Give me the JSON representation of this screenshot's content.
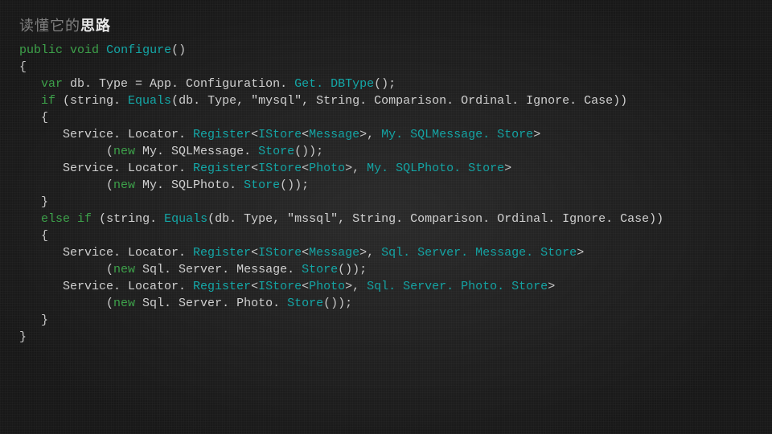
{
  "slide": {
    "title_gray": "读懂它的",
    "title_white": "思路"
  },
  "code": {
    "l01_kw1": "public",
    "l01_kw2": "void",
    "l01_fn": "Configure",
    "l01_tail": "()",
    "l02": "{",
    "l03_indent": "   ",
    "l03_kw": "var",
    "l03_lhs": " db. Type = App. Configuration. ",
    "l03_fn": "Get. DBType",
    "l03_tail": "();",
    "l04_pre": "   if (string. ",
    "l04_fn": "Equals",
    "l04_mid": "(db. Type, \"mysql\", String. Comparison. Ordinal. Ignore. Case))",
    "l04_kw": "if",
    "l05": "   {",
    "l06_pre": "      Service. Locator. ",
    "l06_fn1": "Register",
    "l06_lt1": "<",
    "l06_t1": "IStore",
    "l06_lt2": "<",
    "l06_t2": "Message",
    "l06_gt2": ">",
    "l06_c": ", ",
    "l06_t3": "My. SQLMessage. Store",
    "l06_gt1": ">",
    "l07_pre": "            (",
    "l07_kw": "new",
    "l07_mid": " My. SQLMessage. ",
    "l07_fn": "Store",
    "l07_tail": "());",
    "l08_pre": "      Service. Locator. ",
    "l08_fn1": "Register",
    "l08_t1": "IStore",
    "l08_t2": "Photo",
    "l08_t3": "My. SQLPhoto. Store",
    "l09_pre": "            (",
    "l09_kw": "new",
    "l09_mid": " My. SQLPhoto. ",
    "l09_fn": "Store",
    "l09_tail": "());",
    "l10": "   }",
    "l11_kw1": "else",
    "l11_kw2": "if",
    "l11_pre": "   ",
    "l11_mid": " (string. ",
    "l11_fn": "Equals",
    "l11_tail": "(db. Type, \"mssql\", String. Comparison. Ordinal. Ignore. Case))",
    "l12": "   {",
    "l13_pre": "      Service. Locator. ",
    "l13_fn1": "Register",
    "l13_t1": "IStore",
    "l13_t2": "Message",
    "l13_t3": "Sql. Server. Message. Store",
    "l14_pre": "            (",
    "l14_kw": "new",
    "l14_mid": " Sql. Server. Message. ",
    "l14_fn": "Store",
    "l14_tail": "());",
    "l15_pre": "      Service. Locator. ",
    "l15_fn1": "Register",
    "l15_t1": "IStore",
    "l15_t2": "Photo",
    "l15_t3": "Sql. Server. Photo. Store",
    "l16_pre": "            (",
    "l16_kw": "new",
    "l16_mid": " Sql. Server. Photo. ",
    "l16_fn": "Store",
    "l16_tail": "());",
    "l17": "   }",
    "l18": "}"
  }
}
